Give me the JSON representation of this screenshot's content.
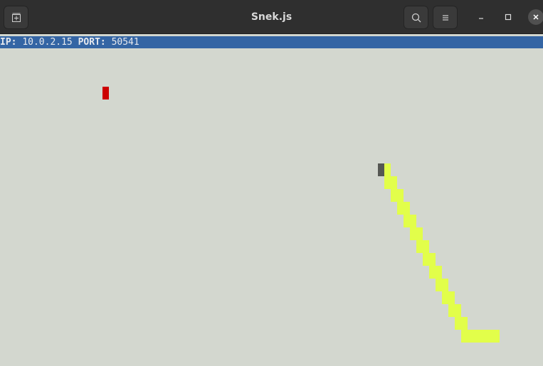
{
  "window": {
    "title": "Snek.js"
  },
  "icons": {
    "new_tab": "new-tab-icon",
    "search": "search-icon",
    "menu": "hamburger-menu-icon",
    "minimize": "minimize-icon",
    "maximize": "maximize-icon",
    "close": "close-icon"
  },
  "status": {
    "ip_label": "IP:",
    "ip_value": "10.0.2.15",
    "port_label": "PORT:",
    "port_value": "50541"
  },
  "colors": {
    "terminal_bg": "#d3d7cf",
    "status_bar": "#3465a4",
    "snake_body": "#e2fe4a",
    "snake_head": "#555753",
    "apple": "#cc0000"
  },
  "game": {
    "apple_cell": [
      16,
      3
    ],
    "snake_head_cell": [
      59,
      9
    ],
    "snake_body_cells": [
      [
        60,
        9
      ],
      [
        60,
        10
      ],
      [
        61,
        10
      ],
      [
        61,
        11
      ],
      [
        62,
        11
      ],
      [
        62,
        12
      ],
      [
        63,
        12
      ],
      [
        63,
        13
      ],
      [
        64,
        13
      ],
      [
        64,
        14
      ],
      [
        65,
        14
      ],
      [
        65,
        15
      ],
      [
        66,
        15
      ],
      [
        66,
        16
      ],
      [
        67,
        16
      ],
      [
        67,
        17
      ],
      [
        68,
        17
      ],
      [
        68,
        18
      ],
      [
        69,
        18
      ],
      [
        69,
        19
      ],
      [
        70,
        19
      ],
      [
        70,
        20
      ],
      [
        71,
        20
      ],
      [
        71,
        21
      ],
      [
        72,
        21
      ],
      [
        72,
        22
      ],
      [
        73,
        22
      ],
      [
        74,
        22
      ],
      [
        75,
        22
      ],
      [
        76,
        22
      ],
      [
        77,
        22
      ]
    ]
  }
}
